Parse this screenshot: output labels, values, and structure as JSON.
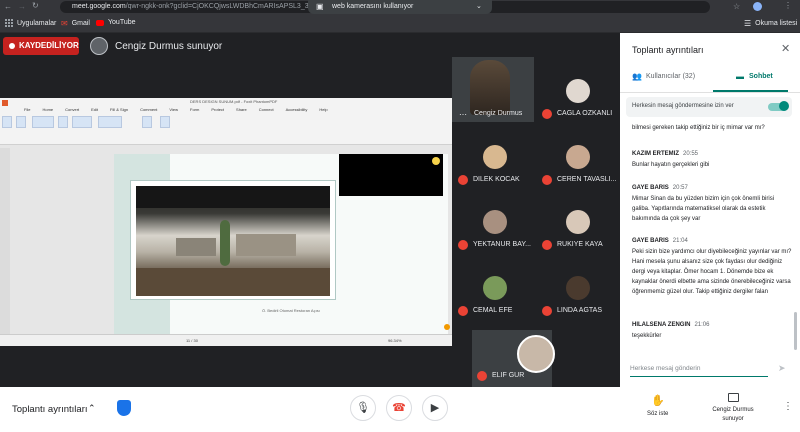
{
  "browser": {
    "url_host": "meet.google.com",
    "url_rest": "/qwr-ngkk-onk?gclid=CjOKCQjwsLWDBhCmARIsAPSL3_3uh...aAktvEALw_wcB&gclsrc=aw.ds",
    "toast": "web kamerasını kullanıyor",
    "bookmarks": [
      "Uygulamalar",
      "Gmail",
      "YouTube"
    ],
    "reading_list": "Okuma listesi"
  },
  "meet": {
    "recording_label": "KAYDEDİLİYOR",
    "presenter_label": "Cengiz Durmus sunuyor"
  },
  "presentation": {
    "window_title": "DERS DESIGN SUNUM.pdf - Foxit PhantomPDF",
    "tabs": [
      "File",
      "Home",
      "Convert",
      "Edit",
      "Fill & Sign",
      "Comment",
      "View",
      "Form",
      "Protect",
      "Share",
      "Connect",
      "Accessibility",
      "Help"
    ],
    "caption": "Ö. Bedirli Otomat Restoran Açısı",
    "page_indicator": "11 / 30",
    "zoom": "96.34%"
  },
  "participants": [
    {
      "name": "Cengiz Durmus",
      "muted": false
    },
    {
      "name": "CAGLA OZKANLI",
      "muted": true
    },
    {
      "name": "DILEK KOCAK",
      "muted": true
    },
    {
      "name": "CEREN TAVASLI...",
      "muted": true
    },
    {
      "name": "YEKTANUR BAY...",
      "muted": true
    },
    {
      "name": "RUKIYE KAYA",
      "muted": true
    },
    {
      "name": "CEMAL EFE",
      "muted": true
    },
    {
      "name": "LINDA AGTAS",
      "muted": true
    },
    {
      "name": "ELIF GUR",
      "muted": true
    }
  ],
  "panel": {
    "title": "Toplantı ayrıntıları",
    "tab_people": "Kullanıcılar (32)",
    "tab_chat": "Sohbet",
    "toggle_label": "Herkesin mesaj göndermesine izin ver",
    "toggle_on": true,
    "input_placeholder": "Herkese mesaj gönderin"
  },
  "chat": [
    {
      "sender": "",
      "time": "",
      "text": "bilmesi gereken takip ettiğiniz bir iç mimar var mı?"
    },
    {
      "sender": "KAZIM ERTEMIZ",
      "time": "20:55",
      "text": "Bunlar hayatın gerçekleri gibi"
    },
    {
      "sender": "GAYE BARIS",
      "time": "20:57",
      "text": "Mimar Sinan da bu yüzden bizim için çok önemli birisi galiba. Yapıtlarında matematiksel olarak da estetik bakımında da çok şey var"
    },
    {
      "sender": "GAYE BARIS",
      "time": "21:04",
      "text": "Peki sizin bize yardımcı olur diyebileceğiniz yayınlar var mı? Hani mesela şunu alsanız size çok faydası olur dediğiniz dergi veya kitaplar. Ömer hocam 1. Dönemde bize ek kaynaklar önerdi elbette ama sizinde önerebileceğiniz varsa öğrenmemiz güzel olur. Takip ettiğiniz dergiler falan"
    },
    {
      "sender": "HILALSENA ZENGIN",
      "time": "21:06",
      "text": "teşekkürler"
    }
  ],
  "bottom": {
    "meeting_details": "Toplantı ayrıntıları",
    "raise_hand": "Söz iste",
    "presenting": "Cengiz Durmus sunuyor"
  }
}
